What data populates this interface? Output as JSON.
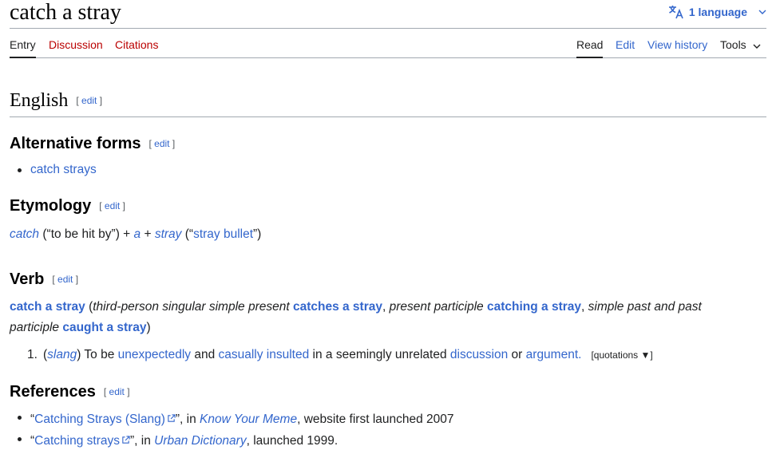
{
  "page": {
    "title": "catch a stray",
    "language_button": "1 language"
  },
  "tabs": {
    "entry": "Entry",
    "discussion": "Discussion",
    "citations": "Citations",
    "read": "Read",
    "edit": "Edit",
    "view_history": "View history",
    "tools": "Tools"
  },
  "edit_label": "edit",
  "sections": {
    "english": "English",
    "alternative_forms": "Alternative forms",
    "etymology": "Etymology",
    "verb": "Verb",
    "references": "References"
  },
  "alternative_forms": [
    "catch strays"
  ],
  "etymology": {
    "w1": "catch",
    "g1_open": " (“",
    "g1": "to be hit by",
    "g1_close": "”) + ",
    "w2": "a",
    "plus": " + ",
    "w3": "stray",
    "g2_open": " (“",
    "g2": "stray bullet",
    "g2_close": "”)"
  },
  "verb": {
    "headword": "catch a stray",
    "l1": "third-person singular simple present",
    "f1": "catches a stray",
    "l2": "present participle",
    "f2": "catching a stray",
    "l3": "simple past and past participle",
    "f3": "caught a stray"
  },
  "definition": {
    "number": "1.",
    "label": "slang",
    "t1": " To be ",
    "l1": "unexpectedly",
    "t2": " and ",
    "l2": "casually insulted",
    "t3": " in a seemingly unrelated ",
    "l3": "discussion",
    "t4": " or ",
    "l4": "argument",
    "t5": ".",
    "quotations": "[quotations ▼]"
  },
  "references": [
    {
      "link": "Catching Strays (Slang)",
      "mid": "”, in ",
      "site": "Know Your Meme",
      "tail": ", website first launched 2007"
    },
    {
      "link": "Catching strays",
      "mid": "”, in ",
      "site": "Urban Dictionary",
      "tail": ", launched 1999."
    }
  ],
  "colors": {
    "link": "#3366cc",
    "red_link": "#ba0000",
    "text": "#202122"
  },
  "icons": {
    "language": "translate-icon",
    "chevron": "chevron-down-icon",
    "external": "external-link-icon"
  }
}
